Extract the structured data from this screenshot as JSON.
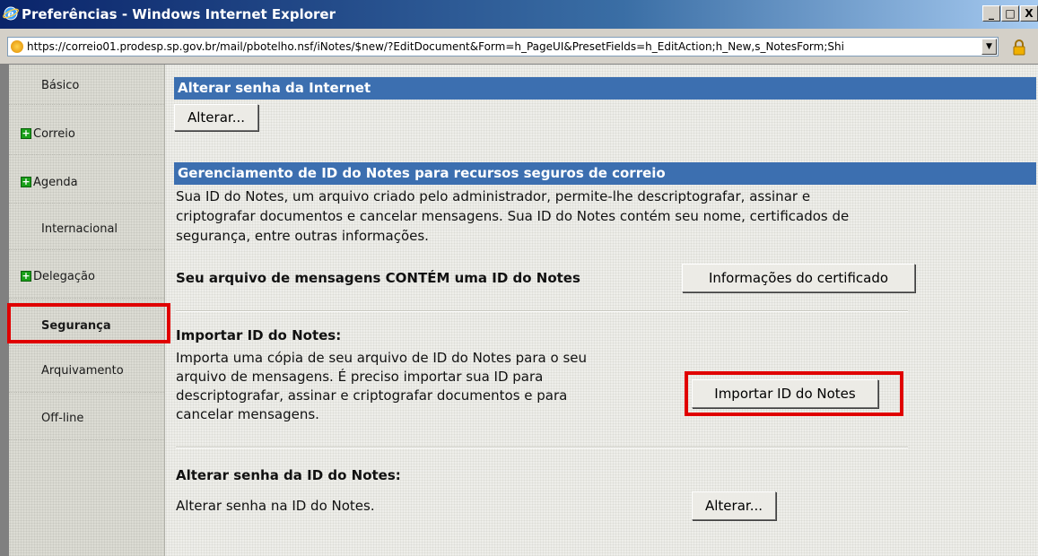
{
  "window": {
    "title": "Preferências - Windows Internet Explorer",
    "buttons": [
      "_",
      "□",
      "X"
    ]
  },
  "address": {
    "url": "https://correio01.prodesp.sp.gov.br/mail/pbotelho.nsf/iNotes/$new/?EditDocument&Form=h_PageUI&PresetFields=h_EditAction;h_New,s_NotesForm;Shi"
  },
  "sidebar": {
    "items": [
      {
        "label": "Básico"
      },
      {
        "label": "Correio"
      },
      {
        "label": "Agenda"
      },
      {
        "label": "Internacional"
      },
      {
        "label": "Delegação"
      },
      {
        "label": "Segurança"
      },
      {
        "label": "Arquivamento"
      },
      {
        "label": "Off-line"
      }
    ]
  },
  "internet_password": {
    "header": "Alterar senha da Internet",
    "button": "Alterar..."
  },
  "id_management": {
    "header": "Gerenciamento de ID do Notes para recursos seguros de correio",
    "description_lines": [
      "Sua ID do Notes, um arquivo criado pelo administrador, permite-lhe descriptografar, assinar e",
      "criptografar documentos e cancelar mensagens. Sua ID do Notes contém seu nome, certificados de",
      "segurança, entre outras informações."
    ],
    "contains_label": "Seu arquivo de mensagens CONTÉM uma ID do Notes",
    "cert_button": "Informações do certificado"
  },
  "import_id": {
    "title": "Importar ID do Notes:",
    "description_lines": [
      "Importa uma cópia de seu arquivo de ID do Notes para o seu",
      "arquivo de mensagens. É preciso importar sua ID para",
      "descriptografar, assinar e criptografar documentos e para",
      "cancelar mensagens."
    ],
    "button": "Importar ID do Notes"
  },
  "change_id_password": {
    "title": "Alterar senha da ID do Notes:",
    "description": "Alterar senha na ID do Notes.",
    "button": "Alterar..."
  },
  "colors": {
    "header_blue": "#3c6fb0",
    "highlight_red": "#e00000",
    "titlebar_dark": "#0a246a"
  }
}
